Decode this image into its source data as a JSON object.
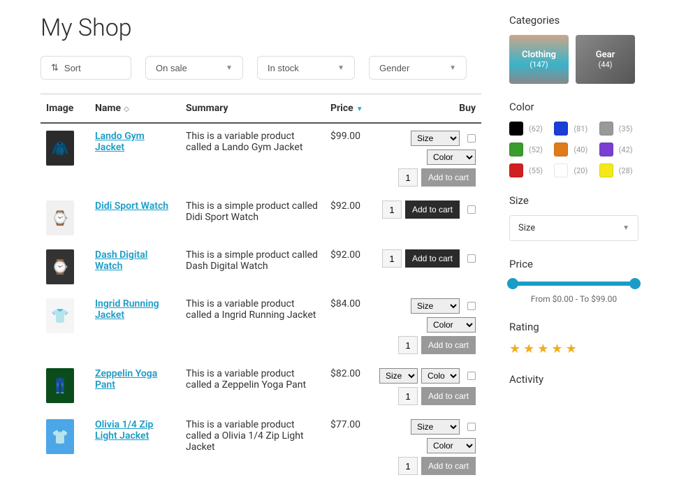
{
  "header": {
    "title": "My Shop"
  },
  "filters": {
    "sort_label": "Sort",
    "dropdowns": [
      "On sale",
      "In stock",
      "Gender"
    ]
  },
  "table": {
    "cols": {
      "image": "Image",
      "name": "Name",
      "summary": "Summary",
      "price": "Price",
      "buy": "Buy"
    },
    "size_opt": "Size",
    "color_opt": "Color",
    "qty_default": "1",
    "addcart_label": "Add to cart",
    "rows": [
      {
        "name": "Lando Gym Jacket",
        "summary": "This is a variable product called a Lando Gym Jacket",
        "price": "$99.00",
        "variable": true,
        "split": true,
        "icon": "🧥",
        "bg": "#2b2b2b"
      },
      {
        "name": "Didi Sport Watch",
        "summary": "This is a simple product called Didi Sport Watch",
        "price": "$92.00",
        "variable": false,
        "icon": "⌚",
        "bg": "#f0f0f0"
      },
      {
        "name": "Dash Digital Watch",
        "summary": "This is a simple product called Dash Digital Watch",
        "price": "$92.00",
        "variable": false,
        "icon": "⌚",
        "bg": "#333"
      },
      {
        "name": "Ingrid Running Jacket",
        "summary": "This is a variable product called a Ingrid Running Jacket",
        "price": "$84.00",
        "variable": true,
        "split": true,
        "icon": "👕",
        "bg": "#f5f5f5"
      },
      {
        "name": "Zeppelin Yoga Pant",
        "summary": "This is a variable product called a Zeppelin Yoga Pant",
        "price": "$82.00",
        "variable": true,
        "split": false,
        "icon": "👖",
        "bg": "#0a4d1a"
      },
      {
        "name": "Olivia 1/4 Zip Light Jacket",
        "summary": "This is a variable product called a Olivia 1/4 Zip Light Jacket",
        "price": "$77.00",
        "variable": true,
        "split": true,
        "icon": "👕",
        "bg": "#4da6e8"
      }
    ]
  },
  "sidebar": {
    "categories_title": "Categories",
    "categories": [
      {
        "name": "Clothing",
        "count": "(147)",
        "cls": "cat-clothing"
      },
      {
        "name": "Gear",
        "count": "(44)",
        "cls": "cat-gear"
      }
    ],
    "color_title": "Color",
    "colors": [
      {
        "hex": "#000000",
        "count": "(62)"
      },
      {
        "hex": "#1a3ed6",
        "count": "(81)"
      },
      {
        "hex": "#999999",
        "count": "(35)"
      },
      {
        "hex": "#3a9b2e",
        "count": "(52)"
      },
      {
        "hex": "#e07b1a",
        "count": "(40)"
      },
      {
        "hex": "#7a3fd1",
        "count": "(42)"
      },
      {
        "hex": "#d11f1f",
        "count": "(55)"
      },
      {
        "hex": "#ffffff",
        "count": "(20)"
      },
      {
        "hex": "#f5e81a",
        "count": "(28)"
      }
    ],
    "size_title": "Size",
    "size_placeholder": "Size",
    "price_title": "Price",
    "price_text": "From $0.00 - To $99.00",
    "rating_title": "Rating",
    "activity_title": "Activity"
  }
}
